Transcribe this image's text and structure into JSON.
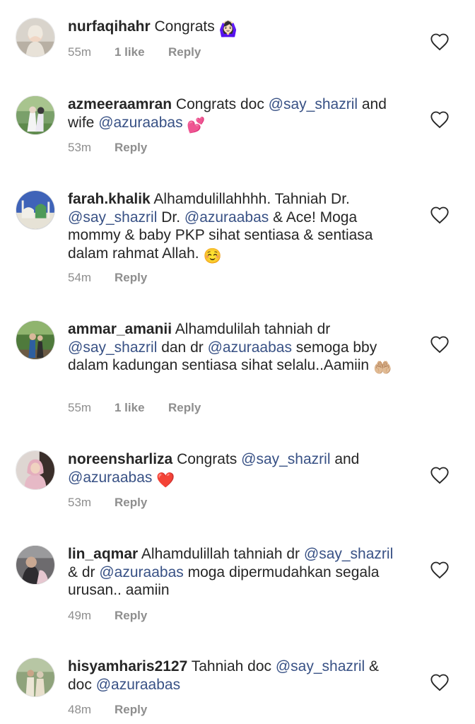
{
  "comments": [
    {
      "username": "nurfaqihahr",
      "text_parts": [
        " Congrats "
      ],
      "emoji": "🙆🏻‍♀️",
      "time": "55m",
      "likes": "1 like",
      "reply": "Reply"
    },
    {
      "username": "azmeeraamran",
      "p1": " Congrats doc ",
      "m1": "@say_shazril",
      "p2": " and wife ",
      "m2": "@azuraabas",
      "emoji": "💕",
      "time": "53m",
      "reply": "Reply"
    },
    {
      "username": "farah.khalik",
      "p1": " Alhamdulillahhhh. Tahniah Dr. ",
      "m1": "@say_shazril",
      "p2": " Dr. ",
      "m2": "@azuraabas",
      "p3": " & Ace! Moga mommy & baby PKP sihat sentiasa & sentiasa dalam rahmat Allah. ",
      "emoji": "☺️",
      "time": "54m",
      "reply": "Reply"
    },
    {
      "username": "ammar_amanii",
      "p1": " Alhamdulilah tahniah dr ",
      "m1": "@say_shazril",
      "p2": "  dan dr ",
      "m2": "@azuraabas",
      "p3": " semoga bby dalam kadungan sentiasa sihat selalu..Aamiin ",
      "emoji": "🤲🏼",
      "time": "55m",
      "likes": "1 like",
      "reply": "Reply"
    },
    {
      "username": "noreensharliza",
      "p1": " Congrats ",
      "m1": "@say_shazril",
      "p2": " and ",
      "m2": "@azuraabas",
      "p3": " ",
      "emoji": "❤️",
      "time": "53m",
      "reply": "Reply"
    },
    {
      "username": "lin_aqmar",
      "p1": " Alhamdulillah tahniah dr ",
      "m1": "@say_shazril",
      "p2": " & dr ",
      "m2": "@azuraabas",
      "p3": " moga dipermudahkan segala urusan.. aamiin",
      "time": "49m",
      "reply": "Reply"
    },
    {
      "username": "hisyamharis2127",
      "p1": " Tahniah doc ",
      "m1": "@say_shazril",
      "p2": " & doc ",
      "m2": "@azuraabas",
      "time": "48m",
      "reply": "Reply"
    }
  ],
  "icons": {
    "like": "heart-outline-icon"
  },
  "colors": {
    "mention": "#385185",
    "meta": "#8e8e8e",
    "text": "#262626"
  }
}
